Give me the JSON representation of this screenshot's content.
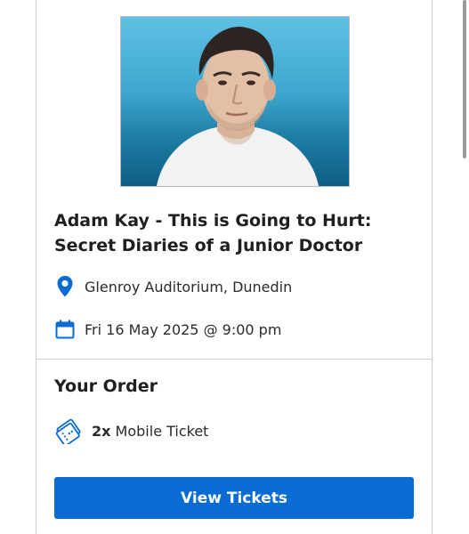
{
  "event": {
    "photo_alt": "Adam Kay",
    "title_line1": "Adam Kay - This is Going to Hurt:",
    "title_line2": "Secret Diaries of a Junior Doctor",
    "venue": "Glenroy Auditorium, Dunedin",
    "datetime": "Fri 16 May 2025 @ 9:00 pm"
  },
  "order": {
    "heading": "Your Order",
    "ticket_qty": "2x",
    "ticket_type": "Mobile Ticket"
  },
  "actions": {
    "view_tickets_label": "View Tickets"
  },
  "icons": {
    "venue": "location-pin-icon",
    "date": "calendar-icon",
    "ticket": "mobile-ticket-icon"
  },
  "colors": {
    "accent": "#0a6bd4",
    "text": "#1f1f1f",
    "border": "#cfcfcf",
    "photo_background": "#3ea7ce"
  }
}
